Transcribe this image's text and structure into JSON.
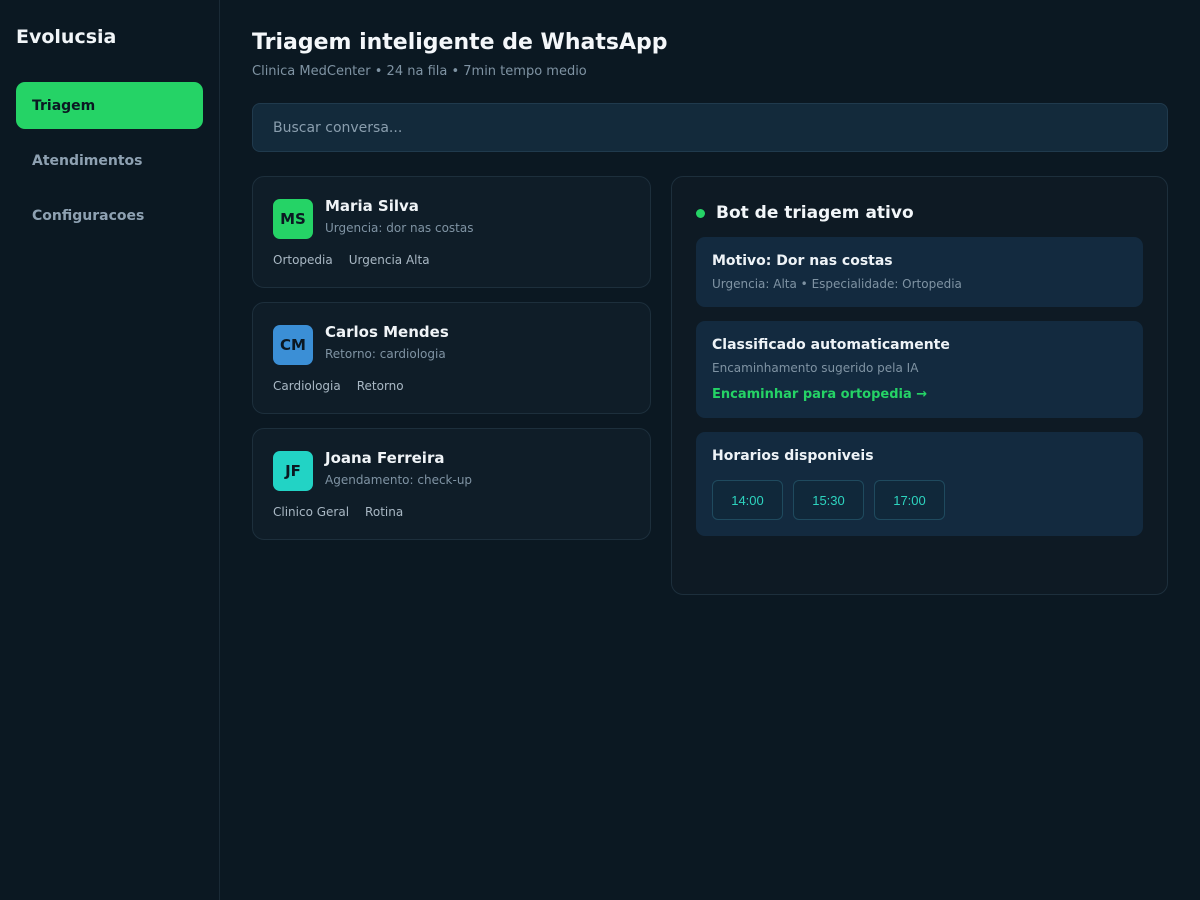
{
  "sidebar": {
    "brand": "Evolucsia",
    "items": [
      {
        "label": "Triagem",
        "active": true
      },
      {
        "label": "Atendimentos",
        "active": false
      },
      {
        "label": "Configuracoes",
        "active": false
      }
    ]
  },
  "header": {
    "title": "Triagem inteligente de WhatsApp",
    "subtitle": "Clinica MedCenter • 24 na fila • 7min tempo medio"
  },
  "search": {
    "placeholder": "Buscar conversa...",
    "value": ""
  },
  "conversations": [
    {
      "initials": "MS",
      "name": "Maria Silva",
      "desc": "Urgencia: dor nas costas",
      "tags": [
        "Ortopedia",
        "Urgencia Alta"
      ],
      "avatar_color": "#25d366"
    },
    {
      "initials": "CM",
      "name": "Carlos Mendes",
      "desc": "Retorno: cardiologia",
      "tags": [
        "Cardiologia",
        "Retorno"
      ],
      "avatar_color": "#3b8fd6"
    },
    {
      "initials": "JF",
      "name": "Joana Ferreira",
      "desc": "Agendamento: check-up",
      "tags": [
        "Clinico Geral",
        "Rotina"
      ],
      "avatar_color": "#22d3c5"
    }
  ],
  "bot": {
    "title": "Bot de triagem ativo",
    "status_color": "#25d366",
    "motivo": {
      "title": "Motivo: Dor nas costas",
      "desc": "Urgencia: Alta • Especialidade: Ortopedia"
    },
    "classificacao": {
      "title": "Classificado automaticamente",
      "desc": "Encaminhamento sugerido pela IA",
      "link": "Encaminhar para ortopedia →"
    },
    "horarios": {
      "title": "Horarios disponiveis",
      "slots": [
        "14:00",
        "15:30",
        "17:00"
      ]
    }
  },
  "colors": {
    "accent": "#25d366",
    "background": "#0b1822",
    "slot_text": "#2dd4bf"
  }
}
